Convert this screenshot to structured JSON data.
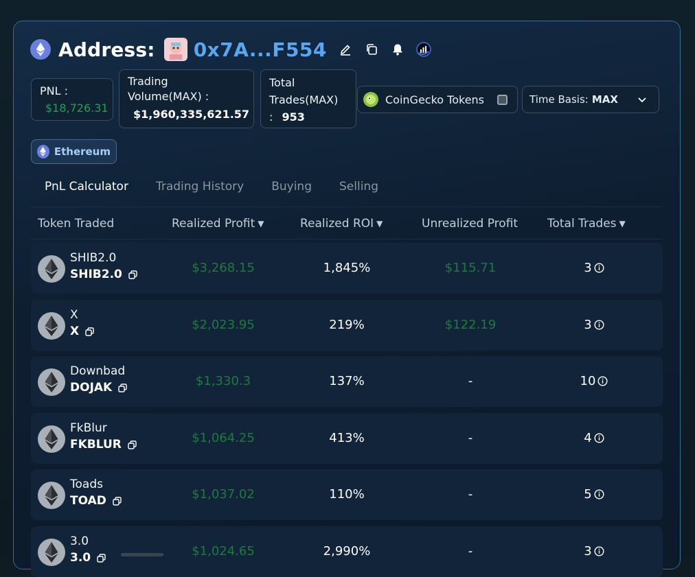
{
  "header": {
    "title": "Address:",
    "address": "0x7A...F554"
  },
  "stats": {
    "pnl_label": "PNL :",
    "pnl_value": "$18,726.31",
    "volume_label_1": "Trading",
    "volume_label_2": "Volume(MAX) :",
    "volume_value": "$1,960,335,621.57",
    "trades_label_1": "Total",
    "trades_label_2": "Trades(MAX)",
    "trades_label_3": ":",
    "trades_value": "953"
  },
  "filters": {
    "coingecko_label": "CoinGecko Tokens",
    "coingecko_checked": false,
    "time_basis_label": "Time Basis:",
    "time_basis_value": "MAX"
  },
  "chain": {
    "label": "Ethereum"
  },
  "tabs": [
    {
      "label": "PnL Calculator",
      "active": true
    },
    {
      "label": "Trading History",
      "active": false
    },
    {
      "label": "Buying",
      "active": false
    },
    {
      "label": "Selling",
      "active": false
    }
  ],
  "table": {
    "columns": [
      "Token Traded",
      "Realized Profit",
      "Realized ROI",
      "Unrealized Profit",
      "Total Trades"
    ],
    "rows": [
      {
        "name": "SHIB2.0",
        "symbol": "SHIB2.0",
        "realized_profit": "$3,268.15",
        "roi": "1,845%",
        "unrealized": "$115.71",
        "trades": "3"
      },
      {
        "name": "X",
        "symbol": "X",
        "realized_profit": "$2,023.95",
        "roi": "219%",
        "unrealized": "$122.19",
        "trades": "3"
      },
      {
        "name": "Downbad",
        "symbol": "DOJAK",
        "realized_profit": "$1,330.3",
        "roi": "137%",
        "unrealized": "-",
        "trades": "10"
      },
      {
        "name": "FkBlur",
        "symbol": "FKBLUR",
        "realized_profit": "$1,064.25",
        "roi": "413%",
        "unrealized": "-",
        "trades": "4"
      },
      {
        "name": "Toads",
        "symbol": "TOAD",
        "realized_profit": "$1,037.02",
        "roi": "110%",
        "unrealized": "-",
        "trades": "5"
      },
      {
        "name": "3.0",
        "symbol": "3.0",
        "realized_profit": "$1,024.65",
        "roi": "2,990%",
        "unrealized": "-",
        "trades": "3"
      }
    ]
  },
  "colors": {
    "accent": "#5aa6f2",
    "profit_green": "#1f7a3e",
    "panel_border": "#2f6f95"
  }
}
